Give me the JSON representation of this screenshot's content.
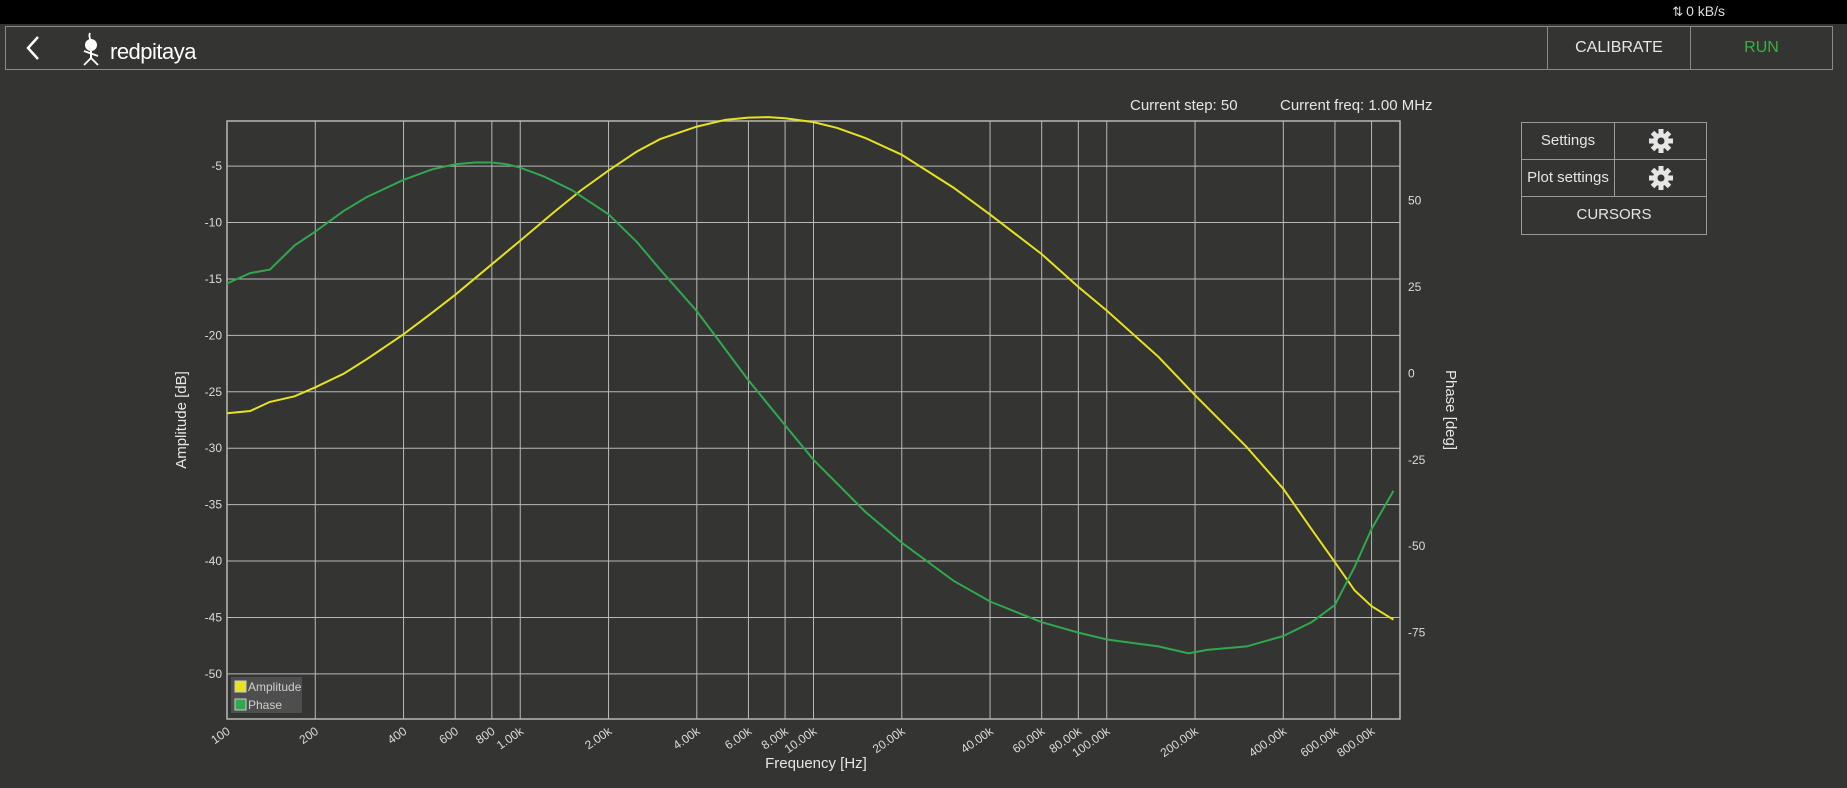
{
  "topbar": {
    "net_rate": "0 kB/s"
  },
  "header": {
    "logo_text": "redpitaya",
    "calibrate_label": "CALIBRATE",
    "run_label": "RUN"
  },
  "status": {
    "step": "Current step: 50",
    "freq": "Current freq: 1.00 MHz"
  },
  "panel": {
    "settings_label": "Settings",
    "plot_settings_label": "Plot settings",
    "cursors_label": "CURSORS"
  },
  "colors": {
    "amplitude": "#e6e21f",
    "phase": "#2fa84f",
    "run": "#3cb043",
    "grid": "#b8b8b8"
  },
  "chart_data": {
    "type": "line",
    "xlabel": "Frequency [Hz]",
    "ylabel": "Amplitude [dB]",
    "y2label": "Phase [deg]",
    "xscale": "log",
    "xlim": [
      100,
      1000000
    ],
    "ylim": [
      -54,
      -1
    ],
    "y2lim": [
      -100,
      73
    ],
    "grid": true,
    "legend_position": "bottom-left",
    "x_ticks": [
      {
        "v": 100,
        "t": "100"
      },
      {
        "v": 200,
        "t": "200"
      },
      {
        "v": 400,
        "t": "400"
      },
      {
        "v": 600,
        "t": "600"
      },
      {
        "v": 800,
        "t": "800"
      },
      {
        "v": 1000,
        "t": "1.00k"
      },
      {
        "v": 2000,
        "t": "2.00k"
      },
      {
        "v": 4000,
        "t": "4.00k"
      },
      {
        "v": 6000,
        "t": "6.00k"
      },
      {
        "v": 8000,
        "t": "8.00k"
      },
      {
        "v": 10000,
        "t": "10.00k"
      },
      {
        "v": 20000,
        "t": "20.00k"
      },
      {
        "v": 40000,
        "t": "40.00k"
      },
      {
        "v": 60000,
        "t": "60.00k"
      },
      {
        "v": 80000,
        "t": "80.00k"
      },
      {
        "v": 100000,
        "t": "100.00k"
      },
      {
        "v": 200000,
        "t": "200.00k"
      },
      {
        "v": 400000,
        "t": "400.00k"
      },
      {
        "v": 600000,
        "t": "600.00k"
      },
      {
        "v": 800000,
        "t": "800.00k"
      }
    ],
    "y_ticks": [
      {
        "v": -5,
        "t": "-5"
      },
      {
        "v": -10,
        "t": "-10"
      },
      {
        "v": -15,
        "t": "-15"
      },
      {
        "v": -20,
        "t": "-20"
      },
      {
        "v": -25,
        "t": "-25"
      },
      {
        "v": -30,
        "t": "-30"
      },
      {
        "v": -35,
        "t": "-35"
      },
      {
        "v": -40,
        "t": "-40"
      },
      {
        "v": -45,
        "t": "-45"
      },
      {
        "v": -50,
        "t": "-50"
      }
    ],
    "y2_ticks": [
      {
        "v": 50,
        "t": "50"
      },
      {
        "v": 25,
        "t": "25"
      },
      {
        "v": 0,
        "t": "0"
      },
      {
        "v": -25,
        "t": "-25"
      },
      {
        "v": -50,
        "t": "-50"
      },
      {
        "v": -75,
        "t": "-75"
      }
    ],
    "series": [
      {
        "name": "Amplitude",
        "axis": "left",
        "points": [
          [
            100,
            -26.9
          ],
          [
            120,
            -26.7
          ],
          [
            140,
            -25.9
          ],
          [
            170,
            -25.4
          ],
          [
            200,
            -24.6
          ],
          [
            250,
            -23.4
          ],
          [
            300,
            -22.1
          ],
          [
            400,
            -19.9
          ],
          [
            500,
            -18.0
          ],
          [
            600,
            -16.4
          ],
          [
            800,
            -13.7
          ],
          [
            1000,
            -11.6
          ],
          [
            1300,
            -9.1
          ],
          [
            1600,
            -7.2
          ],
          [
            2000,
            -5.4
          ],
          [
            2500,
            -3.7
          ],
          [
            3000,
            -2.6
          ],
          [
            4000,
            -1.5
          ],
          [
            5000,
            -0.9
          ],
          [
            6000,
            -0.7
          ],
          [
            7000,
            -0.65
          ],
          [
            8000,
            -0.75
          ],
          [
            10000,
            -1.1
          ],
          [
            12000,
            -1.6
          ],
          [
            15000,
            -2.5
          ],
          [
            20000,
            -4.0
          ],
          [
            30000,
            -6.9
          ],
          [
            40000,
            -9.3
          ],
          [
            60000,
            -12.8
          ],
          [
            80000,
            -15.7
          ],
          [
            100000,
            -17.8
          ],
          [
            150000,
            -21.9
          ],
          [
            200000,
            -25.3
          ],
          [
            300000,
            -29.9
          ],
          [
            400000,
            -33.6
          ],
          [
            500000,
            -37.2
          ],
          [
            600000,
            -40.1
          ],
          [
            700000,
            -42.6
          ],
          [
            800000,
            -44.0
          ],
          [
            950000,
            -45.2
          ]
        ]
      },
      {
        "name": "Phase",
        "axis": "right",
        "points": [
          [
            100,
            26
          ],
          [
            120,
            29
          ],
          [
            140,
            30
          ],
          [
            170,
            37
          ],
          [
            200,
            41
          ],
          [
            250,
            47
          ],
          [
            300,
            51
          ],
          [
            400,
            56
          ],
          [
            500,
            59
          ],
          [
            600,
            60.5
          ],
          [
            700,
            61
          ],
          [
            800,
            61
          ],
          [
            900,
            60.5
          ],
          [
            1000,
            59.5
          ],
          [
            1200,
            57
          ],
          [
            1500,
            53
          ],
          [
            2000,
            46
          ],
          [
            2500,
            38
          ],
          [
            3000,
            30
          ],
          [
            4000,
            18
          ],
          [
            5000,
            7
          ],
          [
            6000,
            -2
          ],
          [
            8000,
            -15
          ],
          [
            10000,
            -25
          ],
          [
            15000,
            -40
          ],
          [
            20000,
            -49
          ],
          [
            30000,
            -60
          ],
          [
            40000,
            -66
          ],
          [
            60000,
            -72
          ],
          [
            80000,
            -75
          ],
          [
            100000,
            -77
          ],
          [
            150000,
            -79
          ],
          [
            190000,
            -81
          ],
          [
            220000,
            -80
          ],
          [
            300000,
            -79
          ],
          [
            400000,
            -76
          ],
          [
            500000,
            -72
          ],
          [
            600000,
            -67
          ],
          [
            700000,
            -56
          ],
          [
            800000,
            -45
          ],
          [
            950000,
            -34
          ]
        ]
      }
    ]
  }
}
